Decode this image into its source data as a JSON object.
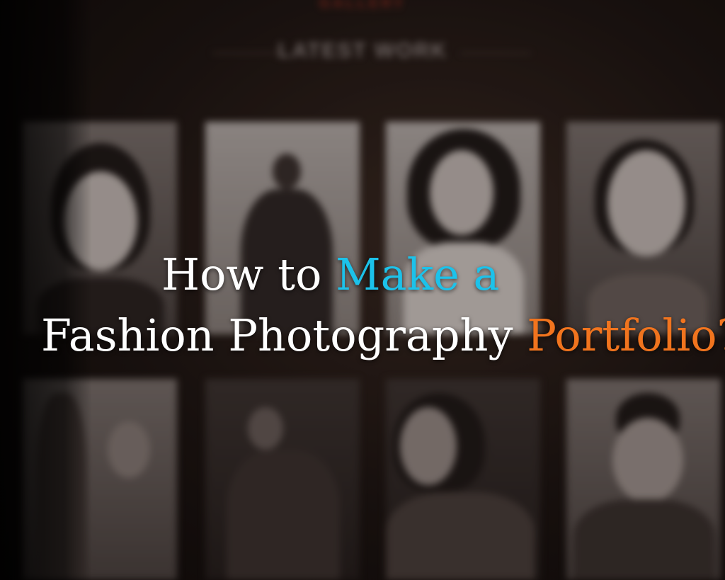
{
  "gallery": {
    "kicker": "GALLERY",
    "title": "LATEST WORK"
  },
  "headline": {
    "line1_plain": "How to",
    "line1_accent": "Make a",
    "line2_plain": "Fashion Photography",
    "line2_accent": "Portfolio?"
  },
  "colors": {
    "accent_blue": "#1cc2ea",
    "accent_orange": "#f1741e",
    "text_white": "#ffffff",
    "background_dark": "#0b0807"
  }
}
